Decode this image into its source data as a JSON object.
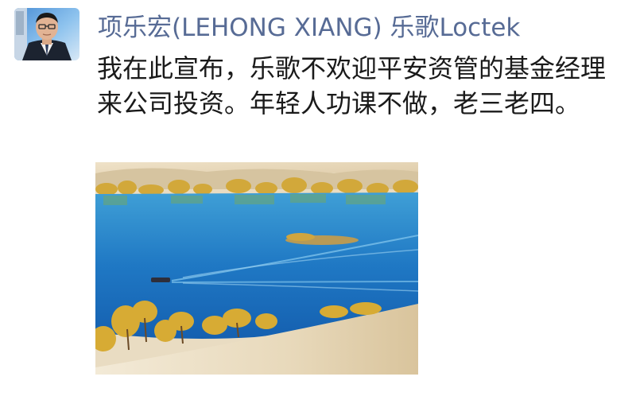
{
  "post": {
    "author_name": "项乐宏(LEHONG XIANG) 乐歌Loctek",
    "content_text": "我在此宣布，乐歌不欢迎平安资管的基金经理来公司投资。年轻人功课不做，老三老四。"
  },
  "colors": {
    "author_name": "#576b95",
    "text": "#1a1a1a",
    "background": "#ffffff"
  },
  "icons": {
    "avatar": "avatar-photo",
    "image": "desert-lake-photo"
  }
}
